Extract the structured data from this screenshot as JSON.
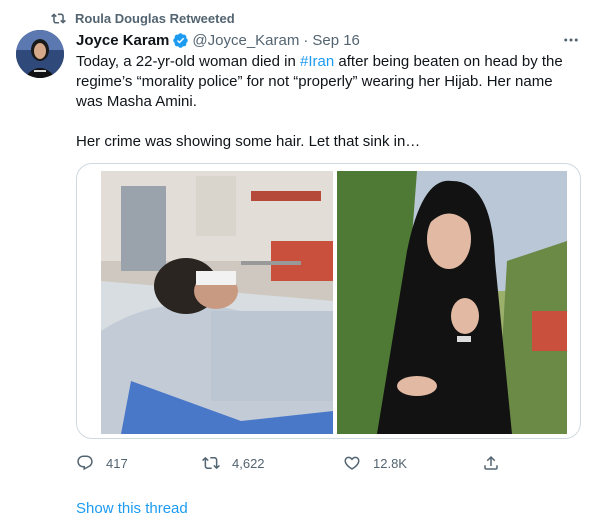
{
  "retweet": {
    "label": "Roula Douglas Retweeted",
    "icon": "retweet-icon"
  },
  "author": {
    "name": "Joyce Karam",
    "handle": "@Joyce_Karam",
    "separator": "·",
    "date": "Sep 16",
    "verified_icon": "verified-badge-icon",
    "avatar_icon": "avatar"
  },
  "tweet": {
    "text_part1": "Today, a 22-yr-old woman died in ",
    "hashtag": "#Iran",
    "text_part2": " after being beaten on head  by the regime’s “morality police” for not “properly” wearing her Hijab. Her name was Masha Amini.",
    "text_line2": "Her crime was showing some hair. Let that sink in…"
  },
  "actions": {
    "replies": "417",
    "retweets": "4,622",
    "likes": "12.8K"
  },
  "show_thread": "Show this thread",
  "colors": {
    "accent": "#1d9bf0",
    "secondary_text": "#536471",
    "primary_text": "#0f1419",
    "border": "#cfd9de"
  }
}
